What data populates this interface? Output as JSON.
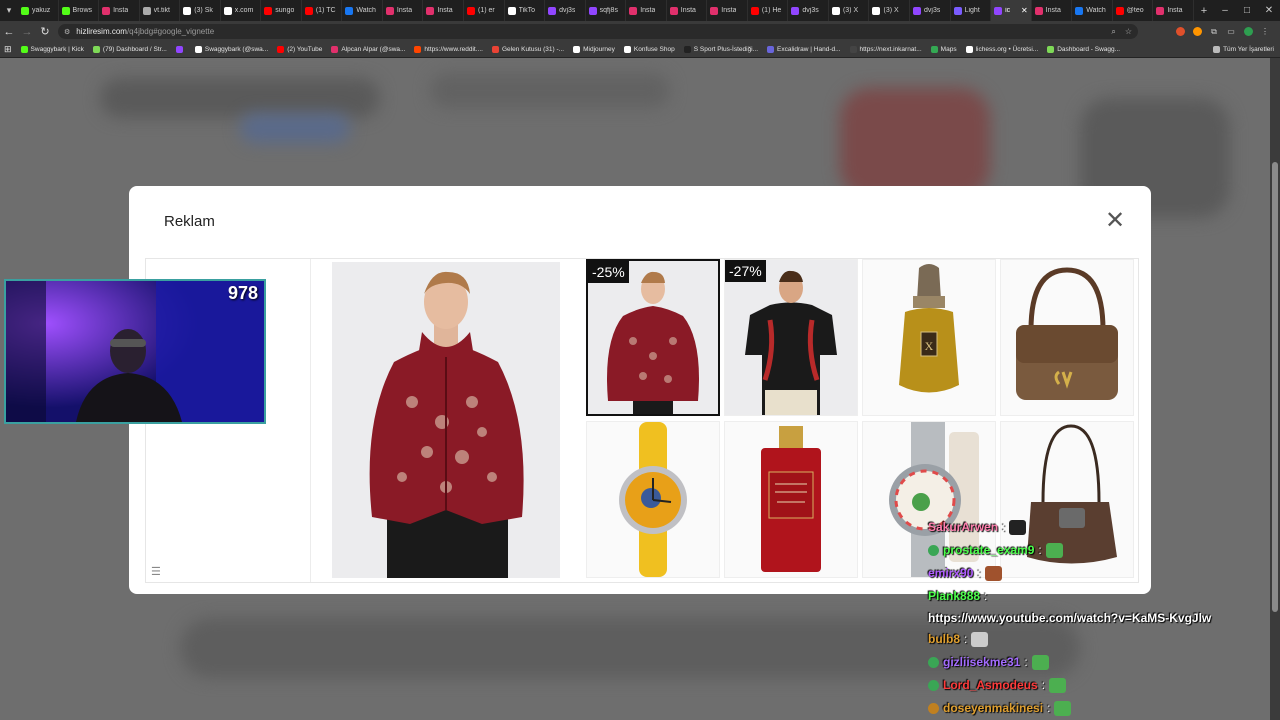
{
  "tabs": [
    {
      "label": "yakuz",
      "color": "#53fc18"
    },
    {
      "label": "Brows",
      "color": "#53fc18"
    },
    {
      "label": "Insta",
      "color": "#e1306c"
    },
    {
      "label": "vt.tikt",
      "color": "#aaaaaa"
    },
    {
      "label": "(3) Sk",
      "color": "#ffffff"
    },
    {
      "label": "x.com",
      "color": "#ffffff"
    },
    {
      "label": "sungo",
      "color": "#ff0000"
    },
    {
      "label": "(1) TC",
      "color": "#ff0000"
    },
    {
      "label": "Watch",
      "color": "#1877f2"
    },
    {
      "label": "Insta",
      "color": "#e1306c"
    },
    {
      "label": "Insta",
      "color": "#e1306c"
    },
    {
      "label": "(1) er",
      "color": "#ff0000"
    },
    {
      "label": "TikTo",
      "color": "#ffffff"
    },
    {
      "label": "dvj3s",
      "color": "#9146ff"
    },
    {
      "label": "sqfj8s",
      "color": "#9146ff"
    },
    {
      "label": "Insta",
      "color": "#e1306c"
    },
    {
      "label": "Insta",
      "color": "#e1306c"
    },
    {
      "label": "Insta",
      "color": "#e1306c"
    },
    {
      "label": "(1) He",
      "color": "#ff0000"
    },
    {
      "label": "dvj3s",
      "color": "#9146ff"
    },
    {
      "label": "(3) X",
      "color": "#ffffff"
    },
    {
      "label": "(3) X",
      "color": "#ffffff"
    },
    {
      "label": "dvj3s",
      "color": "#9146ff"
    },
    {
      "label": "Light",
      "color": "#7a5cff"
    },
    {
      "label": "ic",
      "color": "#9146ff",
      "active": true
    },
    {
      "label": "Insta",
      "color": "#e1306c"
    },
    {
      "label": "Watch",
      "color": "#1877f2"
    },
    {
      "label": "@teo",
      "color": "#ff0000"
    },
    {
      "label": "Insta",
      "color": "#e1306c"
    }
  ],
  "address": {
    "host": "hizliresim.com",
    "path": "/q4jbdg#google_vignette"
  },
  "bookmarks": [
    {
      "label": "Swaggybark | Kick",
      "color": "#53fc18"
    },
    {
      "label": "(79) Dashboard / Str...",
      "color": "#7ed957"
    },
    {
      "label": "",
      "color": "#9146ff"
    },
    {
      "label": "Swaggybark (@swa...",
      "color": "#ffffff"
    },
    {
      "label": "(2) YouTube",
      "color": "#ff0000"
    },
    {
      "label": "Alpcan Alpar (@swa...",
      "color": "#e1306c"
    },
    {
      "label": "https://www.reddit....",
      "color": "#ff4500"
    },
    {
      "label": "Gelen Kutusu (31) -...",
      "color": "#ea4335"
    },
    {
      "label": "Midjourney",
      "color": "#ffffff"
    },
    {
      "label": "Konfuse Shop",
      "color": "#ffffff"
    },
    {
      "label": "S Sport Plus-İstediği...",
      "color": "#222222"
    },
    {
      "label": "Excalidraw | Hand-d...",
      "color": "#6965db"
    },
    {
      "label": "https://next.inkarnat...",
      "color": "#444444"
    },
    {
      "label": "Maps",
      "color": "#34a853"
    },
    {
      "label": "lichess.org • Ücretsi...",
      "color": "#ffffff"
    },
    {
      "label": "Dashboard - Swagg...",
      "color": "#7ed957"
    }
  ],
  "bookmarks_all": "Tüm Yer İşaretleri",
  "ad": {
    "title": "Reklam",
    "close_symbol": "✕",
    "brand_text": "OM",
    "menu_symbol": "☰",
    "discounts": [
      "-25%",
      "-27%"
    ]
  },
  "stream": {
    "viewer_count": "978"
  },
  "chat": [
    {
      "user": "SakurArwen",
      "color": "#ff7fae",
      "badge": "",
      "content": "",
      "emote": "#222222"
    },
    {
      "user": "prostate_exam9",
      "color": "#4cff4c",
      "badge": "#3aa655",
      "content": "",
      "emote": "#4caf50"
    },
    {
      "user": "emirx90",
      "color": "#b05cff",
      "badge": "",
      "content": "",
      "emote": "#a0522d"
    },
    {
      "user": "Plank888",
      "color": "#4cff4c",
      "badge": "",
      "content": "https://www.youtube.com/watch?v=KaMS-KvgJlw",
      "emote": ""
    },
    {
      "user": "bulb8",
      "color": "#e0a030",
      "badge": "",
      "content": "",
      "emote": "#cccccc"
    },
    {
      "user": "gizliisekme31",
      "color": "#a46cff",
      "badge": "#3aa655",
      "content": "",
      "emote": "#4caf50"
    },
    {
      "user": "Lord_Asmodeus",
      "color": "#ff3b3b",
      "badge": "#3aa655",
      "content": "",
      "emote": "#4caf50"
    },
    {
      "user": "doseyenmakinesi",
      "color": "#e0a030",
      "badge": "#c08020",
      "content": "",
      "emote": "#4caf50"
    }
  ]
}
